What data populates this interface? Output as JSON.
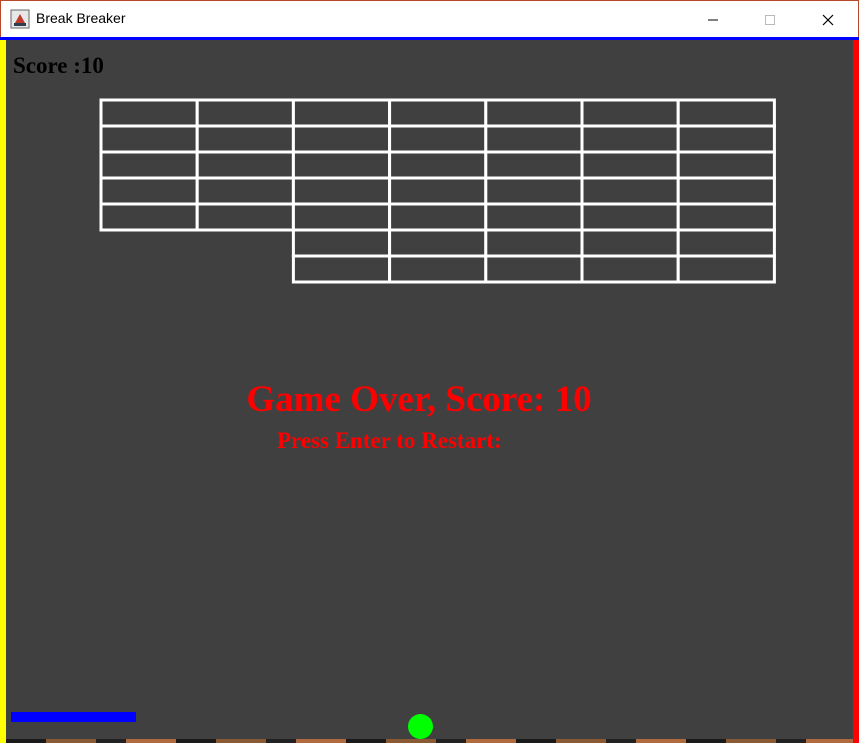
{
  "window": {
    "title": "Break Breaker",
    "icon": "java-cup-icon"
  },
  "hud": {
    "score_label": "Score :10"
  },
  "bricks": {
    "rows": 7,
    "cols": 7,
    "broken": [
      [
        5,
        0
      ],
      [
        5,
        1
      ],
      [
        6,
        0
      ],
      [
        6,
        1
      ]
    ]
  },
  "messages": {
    "game_over": "Game Over, Score: 10",
    "restart": "Press Enter to Restart:"
  },
  "colors": {
    "background": "#404040",
    "brick_border": "#ffffff",
    "message": "#ff0000",
    "paddle": "#0000ff",
    "ball": "#00ff00",
    "left_border": "#ffff00",
    "right_border": "#ff0000"
  }
}
